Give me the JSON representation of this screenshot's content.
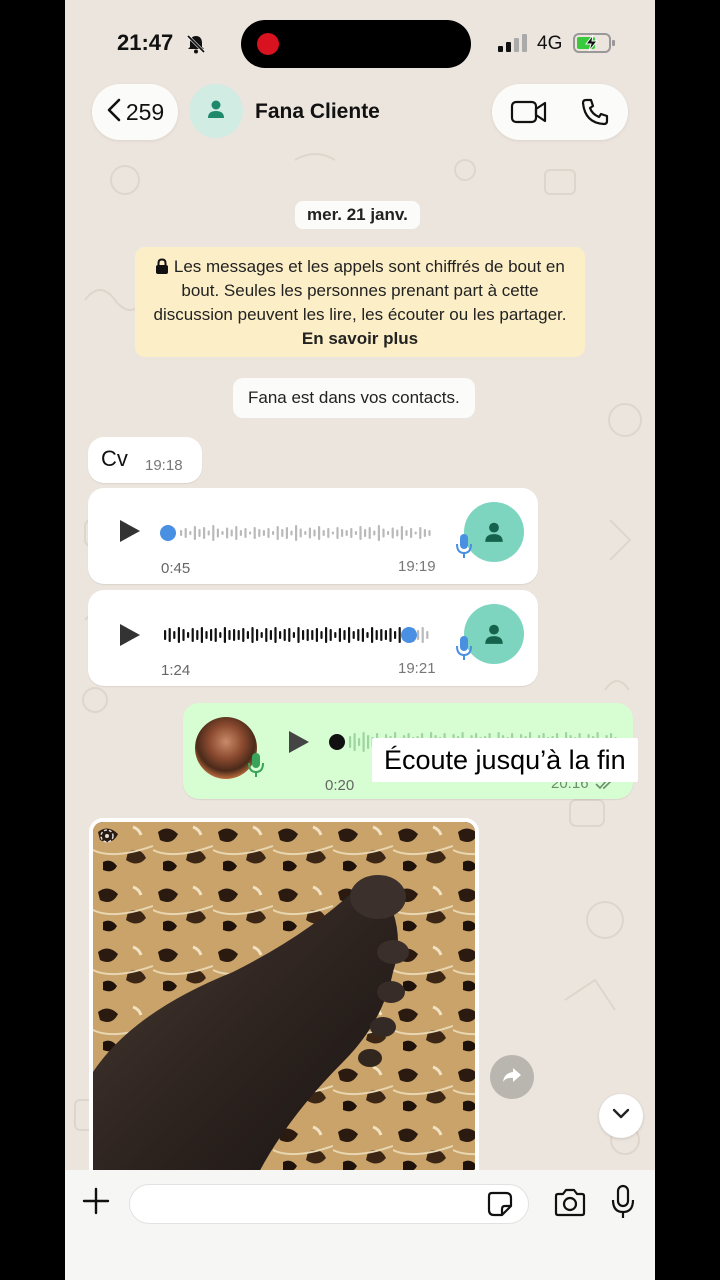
{
  "status_bar": {
    "time": "21:47",
    "network": "4G",
    "recording_color": "#d9121f"
  },
  "header": {
    "back_count": "259",
    "contact_name": "Fana Cliente"
  },
  "chat": {
    "date_chip": "mer. 21 janv.",
    "encryption_notice": "Les messages et les appels sont chiffrés de bout en bout. Seules les personnes prenant part à cette discussion peuvent les lire, les écouter ou les partager.",
    "encryption_link": "En savoir plus",
    "contact_notice": "Fana est dans vos contacts.",
    "messages": [
      {
        "type": "text",
        "direction": "in",
        "text": "Cv",
        "time": "19:18"
      },
      {
        "type": "voice",
        "direction": "in",
        "duration": "0:45",
        "time": "19:19",
        "progress": 0.0
      },
      {
        "type": "voice",
        "direction": "in",
        "duration": "1:24",
        "time": "19:21",
        "progress": 0.92
      },
      {
        "type": "voice",
        "direction": "out",
        "duration": "0:20",
        "time": "20:16",
        "status": "read"
      },
      {
        "type": "image",
        "direction": "in",
        "view_once": true
      }
    ],
    "overlay_caption": "Écoute jusqu’à la fin"
  },
  "composer": {
    "placeholder": ""
  },
  "colors": {
    "accent": "#25d366",
    "bubble_out": "#d7fdd2",
    "bubble_in": "#ffffff",
    "progress_blue": "#4a90e2",
    "notice_bg": "#fcefc7"
  },
  "icons": [
    "bell-off-icon",
    "signal-icon",
    "battery-charging-icon",
    "chevron-left-icon",
    "person-icon",
    "video-icon",
    "phone-icon",
    "lock-icon",
    "play-icon",
    "mic-icon",
    "view-once-icon",
    "forward-icon",
    "chevron-down-icon",
    "plus-icon",
    "sticker-icon",
    "camera-icon",
    "double-check-icon"
  ]
}
